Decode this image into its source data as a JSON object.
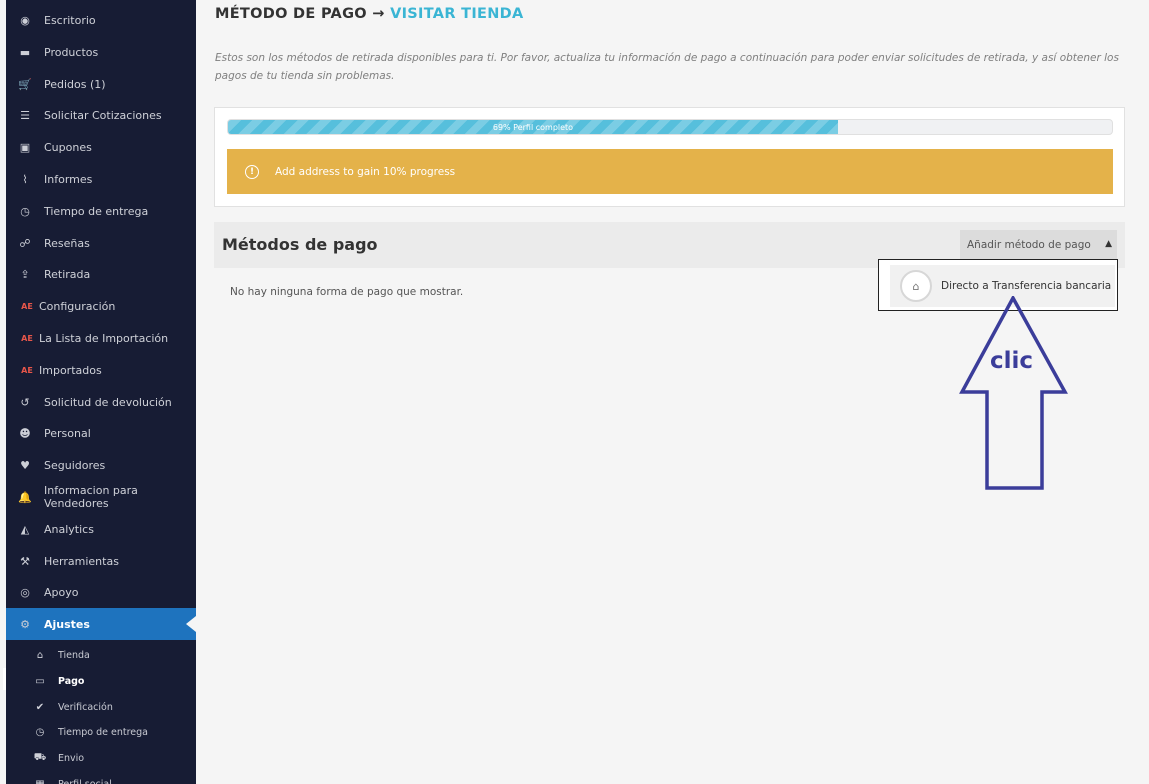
{
  "sidebar": {
    "items": [
      {
        "label": "Escritorio",
        "icon": "dashboard-icon",
        "glyph": "◉"
      },
      {
        "label": "Productos",
        "icon": "briefcase-icon",
        "glyph": "▬"
      },
      {
        "label": "Pedidos (1)",
        "icon": "cart-icon",
        "glyph": "🛒"
      },
      {
        "label": "Solicitar Cotizaciones",
        "icon": "list-icon",
        "glyph": "☰"
      },
      {
        "label": "Cupones",
        "icon": "gift-icon",
        "glyph": "▣"
      },
      {
        "label": "Informes",
        "icon": "chart-icon",
        "glyph": "⌇"
      },
      {
        "label": "Tiempo de entrega",
        "icon": "clock-icon",
        "glyph": "◷"
      },
      {
        "label": "Reseñas",
        "icon": "comments-icon",
        "glyph": "☍"
      },
      {
        "label": "Retirada",
        "icon": "upload-icon",
        "glyph": "⇪"
      },
      {
        "label": "Configuración",
        "icon": "aliexpress-icon",
        "glyph": "AE",
        "aliex": true
      },
      {
        "label": "La Lista de Importación",
        "icon": "aliexpress-icon",
        "glyph": "AE",
        "aliex": true
      },
      {
        "label": "Importados",
        "icon": "aliexpress-icon",
        "glyph": "AE",
        "aliex": true
      },
      {
        "label": "Solicitud de devolución",
        "icon": "return-icon",
        "glyph": "↺"
      },
      {
        "label": "Personal",
        "icon": "users-icon",
        "glyph": "☻"
      },
      {
        "label": "Seguidores",
        "icon": "heart-icon",
        "glyph": "♥"
      },
      {
        "label": "Informacion para Vendedores",
        "icon": "bell-icon",
        "glyph": "🔔"
      },
      {
        "label": "Analytics",
        "icon": "area-chart-icon",
        "glyph": "◭"
      },
      {
        "label": "Herramientas",
        "icon": "wrench-icon",
        "glyph": "⚒"
      },
      {
        "label": "Apoyo",
        "icon": "lifebuoy-icon",
        "glyph": "◎"
      },
      {
        "label": "Ajustes",
        "icon": "gear-icon",
        "glyph": "⚙",
        "active": true
      }
    ],
    "sub_items": [
      {
        "label": "Tienda",
        "icon": "bank-icon",
        "glyph": "⌂"
      },
      {
        "label": "Pago",
        "icon": "credit-card-icon",
        "glyph": "▭",
        "current": true
      },
      {
        "label": "Verificación",
        "icon": "check-icon",
        "glyph": "✔"
      },
      {
        "label": "Tiempo de entrega",
        "icon": "clock-icon",
        "glyph": "◷"
      },
      {
        "label": "Envio",
        "icon": "truck-icon",
        "glyph": "⛟"
      },
      {
        "label": "Perfil social",
        "icon": "share-icon",
        "glyph": "▦"
      }
    ]
  },
  "header": {
    "title": "MÉTODO DE PAGO",
    "arrow": "→",
    "visit_store": "VISITAR TIENDA"
  },
  "description": "Estos son los métodos de retirada disponibles para ti. Por favor, actualiza tu información de pago a continuación para poder enviar solicitudes de retirada, y así obtener los pagos de tu tienda sin problemas.",
  "progress": {
    "percent": 69,
    "label": "69% Perfil completo",
    "alert": "Add address  to gain 10% progress",
    "alert_icon": "!"
  },
  "methods": {
    "title": "Métodos de pago",
    "add_button": "Añadir método de pago",
    "caret": "▲",
    "empty": "No hay ninguna forma de pago que mostrar.",
    "dropdown_option": "Directo a Transferencia bancaria"
  },
  "annotation": {
    "text": "clic",
    "color": "#3b3d9a"
  },
  "colors": {
    "sidebar_bg": "#171c34",
    "active": "#1e73be",
    "progress": "#56bfdc",
    "alert": "#e4b24a",
    "link": "#3ab5d4"
  }
}
